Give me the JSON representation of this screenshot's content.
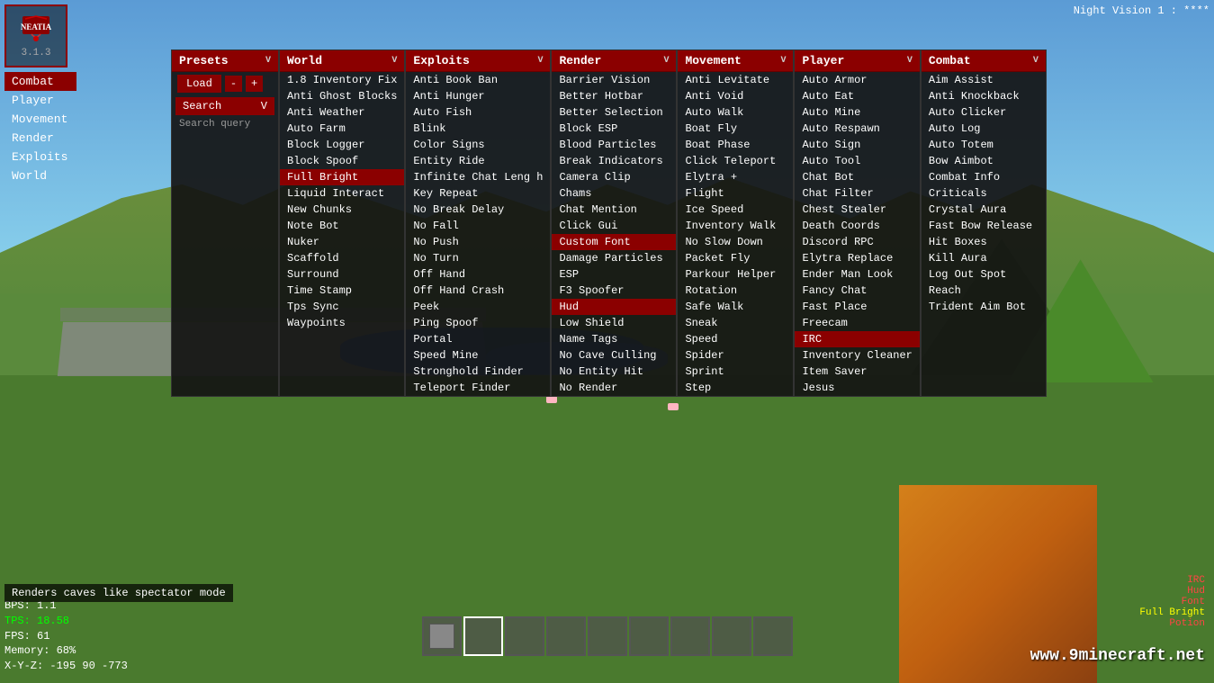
{
  "hud": {
    "night_vision": "Night Vision 1 : ****",
    "version": "3.1.3",
    "logo": "NEATIA",
    "watermark": "www.9minecraft.net",
    "tooltip": "Renders caves like spectator mode",
    "stats": {
      "bps": "BPS: 1.1",
      "tps": "TPS: 18.58",
      "fps": "FPS: 61",
      "memory": "Memory: 68%",
      "xyz": "X-Y-Z: -195 90 -773"
    },
    "hud_br": {
      "irc": "IRC",
      "hud": "Hud",
      "font": "Font",
      "full_bright": "Full Bright",
      "potion": "Potion"
    }
  },
  "side_menu": {
    "items": [
      {
        "label": "Combat",
        "active": true
      },
      {
        "label": "Player",
        "active": false
      },
      {
        "label": "Movement",
        "active": false
      },
      {
        "label": "Render",
        "active": false
      },
      {
        "label": "Exploits",
        "active": false
      },
      {
        "label": "World",
        "active": false
      }
    ]
  },
  "presets_column": {
    "header": "Presets",
    "load_label": "Load",
    "minus_label": "-",
    "plus_label": "+",
    "search_label": "Search",
    "search_arrow": "V",
    "search_query": "Search query"
  },
  "columns": [
    {
      "header": "World",
      "arrow": "V",
      "items": [
        {
          "label": "1.8 Inventory Fix",
          "active": false,
          "highlighted": false
        },
        {
          "label": "Anti Ghost Blocks",
          "active": false,
          "highlighted": false
        },
        {
          "label": "Anti Weather",
          "active": false,
          "highlighted": false
        },
        {
          "label": "Auto Farm",
          "active": false,
          "highlighted": false
        },
        {
          "label": "Block Logger",
          "active": false,
          "highlighted": false
        },
        {
          "label": "Block Spoof",
          "active": false,
          "highlighted": false
        },
        {
          "label": "Full Bright",
          "active": false,
          "highlighted": true
        },
        {
          "label": "Liquid Interact",
          "active": false,
          "highlighted": false
        },
        {
          "label": "New Chunks",
          "active": false,
          "highlighted": false
        },
        {
          "label": "Note Bot",
          "active": false,
          "highlighted": false
        },
        {
          "label": "Nuker",
          "active": false,
          "highlighted": false
        },
        {
          "label": "Scaffold",
          "active": false,
          "highlighted": false
        },
        {
          "label": "Surround",
          "active": false,
          "highlighted": false
        },
        {
          "label": "Time Stamp",
          "active": false,
          "highlighted": false
        },
        {
          "label": "Tps Sync",
          "active": false,
          "highlighted": false
        },
        {
          "label": "Waypoints",
          "active": false,
          "highlighted": false
        }
      ]
    },
    {
      "header": "Exploits",
      "arrow": "V",
      "items": [
        {
          "label": "Anti Book Ban",
          "active": false,
          "highlighted": false
        },
        {
          "label": "Anti Hunger",
          "active": false,
          "highlighted": false
        },
        {
          "label": "Auto Fish",
          "active": false,
          "highlighted": false
        },
        {
          "label": "Blink",
          "active": false,
          "highlighted": false
        },
        {
          "label": "Color Signs",
          "active": false,
          "highlighted": false
        },
        {
          "label": "Entity Ride",
          "active": false,
          "highlighted": false
        },
        {
          "label": "Infinite Chat Leng h",
          "active": false,
          "highlighted": false
        },
        {
          "label": "Key Repeat",
          "active": false,
          "highlighted": false
        },
        {
          "label": "No Break Delay",
          "active": false,
          "highlighted": false
        },
        {
          "label": "No Fall",
          "active": false,
          "highlighted": false
        },
        {
          "label": "No Push",
          "active": false,
          "highlighted": false
        },
        {
          "label": "No Turn",
          "active": false,
          "highlighted": false
        },
        {
          "label": "Off Hand",
          "active": false,
          "highlighted": false
        },
        {
          "label": "Off Hand Crash",
          "active": false,
          "highlighted": false
        },
        {
          "label": "Peek",
          "active": false,
          "highlighted": false
        },
        {
          "label": "Ping Spoof",
          "active": false,
          "highlighted": false
        },
        {
          "label": "Portal",
          "active": false,
          "highlighted": false
        },
        {
          "label": "Speed Mine",
          "active": false,
          "highlighted": false
        },
        {
          "label": "Stronghold Finder",
          "active": false,
          "highlighted": false
        },
        {
          "label": "Teleport Finder",
          "active": false,
          "highlighted": false
        }
      ]
    },
    {
      "header": "Render",
      "arrow": "V",
      "items": [
        {
          "label": "Barrier Vision",
          "active": false,
          "highlighted": false
        },
        {
          "label": "Better Hotbar",
          "active": false,
          "highlighted": false
        },
        {
          "label": "Better Selection",
          "active": false,
          "highlighted": false
        },
        {
          "label": "Block ESP",
          "active": false,
          "highlighted": false
        },
        {
          "label": "Blood Particles",
          "active": false,
          "highlighted": false
        },
        {
          "label": "Break Indicators",
          "active": false,
          "highlighted": false
        },
        {
          "label": "Camera Clip",
          "active": false,
          "highlighted": false
        },
        {
          "label": "Chams",
          "active": false,
          "highlighted": false
        },
        {
          "label": "Chat Mention",
          "active": false,
          "highlighted": false
        },
        {
          "label": "Click Gui",
          "active": false,
          "highlighted": false
        },
        {
          "label": "Custom Font",
          "active": false,
          "highlighted": true
        },
        {
          "label": "Damage Particles",
          "active": false,
          "highlighted": false
        },
        {
          "label": "ESP",
          "active": false,
          "highlighted": false
        },
        {
          "label": "F3 Spoofer",
          "active": false,
          "highlighted": false
        },
        {
          "label": "Hud",
          "active": false,
          "highlighted": true
        },
        {
          "label": "Low Shield",
          "active": false,
          "highlighted": false
        },
        {
          "label": "Name Tags",
          "active": false,
          "highlighted": false
        },
        {
          "label": "No Cave Culling",
          "active": false,
          "highlighted": false
        },
        {
          "label": "No Entity Hit",
          "active": false,
          "highlighted": false
        },
        {
          "label": "No Render",
          "active": false,
          "highlighted": false
        }
      ]
    },
    {
      "header": "Movement",
      "arrow": "V",
      "items": [
        {
          "label": "Anti Levitate",
          "active": false,
          "highlighted": false
        },
        {
          "label": "Anti Void",
          "active": false,
          "highlighted": false
        },
        {
          "label": "Auto Walk",
          "active": false,
          "highlighted": false
        },
        {
          "label": "Boat Fly",
          "active": false,
          "highlighted": false
        },
        {
          "label": "Boat Phase",
          "active": false,
          "highlighted": false
        },
        {
          "label": "Click Teleport",
          "active": false,
          "highlighted": false
        },
        {
          "label": "Elytra +",
          "active": false,
          "highlighted": false
        },
        {
          "label": "Flight",
          "active": false,
          "highlighted": false
        },
        {
          "label": "Ice Speed",
          "active": false,
          "highlighted": false
        },
        {
          "label": "Inventory Walk",
          "active": false,
          "highlighted": false
        },
        {
          "label": "No Slow Down",
          "active": false,
          "highlighted": false
        },
        {
          "label": "Packet Fly",
          "active": false,
          "highlighted": false
        },
        {
          "label": "Parkour Helper",
          "active": false,
          "highlighted": false
        },
        {
          "label": "Rotation",
          "active": false,
          "highlighted": false
        },
        {
          "label": "Safe Walk",
          "active": false,
          "highlighted": false
        },
        {
          "label": "Sneak",
          "active": false,
          "highlighted": false
        },
        {
          "label": "Speed",
          "active": false,
          "highlighted": false
        },
        {
          "label": "Spider",
          "active": false,
          "highlighted": false
        },
        {
          "label": "Sprint",
          "active": false,
          "highlighted": false
        },
        {
          "label": "Step",
          "active": false,
          "highlighted": false
        }
      ]
    },
    {
      "header": "Player",
      "arrow": "V",
      "items": [
        {
          "label": "Auto Armor",
          "active": false,
          "highlighted": false
        },
        {
          "label": "Auto Eat",
          "active": false,
          "highlighted": false
        },
        {
          "label": "Auto Mine",
          "active": false,
          "highlighted": false
        },
        {
          "label": "Auto Respawn",
          "active": false,
          "highlighted": false
        },
        {
          "label": "Auto Sign",
          "active": false,
          "highlighted": false
        },
        {
          "label": "Auto Tool",
          "active": false,
          "highlighted": false
        },
        {
          "label": "Chat Bot",
          "active": false,
          "highlighted": false
        },
        {
          "label": "Chat Filter",
          "active": false,
          "highlighted": false
        },
        {
          "label": "Chest Stealer",
          "active": false,
          "highlighted": false
        },
        {
          "label": "Death Coords",
          "active": false,
          "highlighted": false
        },
        {
          "label": "Discord RPC",
          "active": false,
          "highlighted": false
        },
        {
          "label": "Elytra Replace",
          "active": false,
          "highlighted": false
        },
        {
          "label": "Ender Man Look",
          "active": false,
          "highlighted": false
        },
        {
          "label": "Fancy Chat",
          "active": false,
          "highlighted": false
        },
        {
          "label": "Fast Place",
          "active": false,
          "highlighted": false
        },
        {
          "label": "Freecam",
          "active": false,
          "highlighted": false
        },
        {
          "label": "IRC",
          "active": false,
          "highlighted": true
        },
        {
          "label": "Inventory Cleaner",
          "active": false,
          "highlighted": false
        },
        {
          "label": "Item Saver",
          "active": false,
          "highlighted": false
        },
        {
          "label": "Jesus",
          "active": false,
          "highlighted": false
        }
      ]
    },
    {
      "header": "Combat",
      "arrow": "V",
      "items": [
        {
          "label": "Aim Assist",
          "active": false,
          "highlighted": false
        },
        {
          "label": "Anti Knockback",
          "active": false,
          "highlighted": false
        },
        {
          "label": "Auto Clicker",
          "active": false,
          "highlighted": false
        },
        {
          "label": "Auto Log",
          "active": false,
          "highlighted": false
        },
        {
          "label": "Auto Totem",
          "active": false,
          "highlighted": false
        },
        {
          "label": "Bow Aimbot",
          "active": false,
          "highlighted": false
        },
        {
          "label": "Combat Info",
          "active": false,
          "highlighted": false
        },
        {
          "label": "Criticals",
          "active": false,
          "highlighted": false
        },
        {
          "label": "Crystal Aura",
          "active": false,
          "highlighted": false
        },
        {
          "label": "Fast Bow Release",
          "active": false,
          "highlighted": false
        },
        {
          "label": "Hit Boxes",
          "active": false,
          "highlighted": false
        },
        {
          "label": "Kill Aura",
          "active": false,
          "highlighted": false
        },
        {
          "label": "Log Out Spot",
          "active": false,
          "highlighted": false
        },
        {
          "label": "Reach",
          "active": false,
          "highlighted": false
        },
        {
          "label": "Trident Aim Bot",
          "active": false,
          "highlighted": false
        }
      ]
    }
  ],
  "hotbar": {
    "slots": 9,
    "active_slot": 1
  }
}
